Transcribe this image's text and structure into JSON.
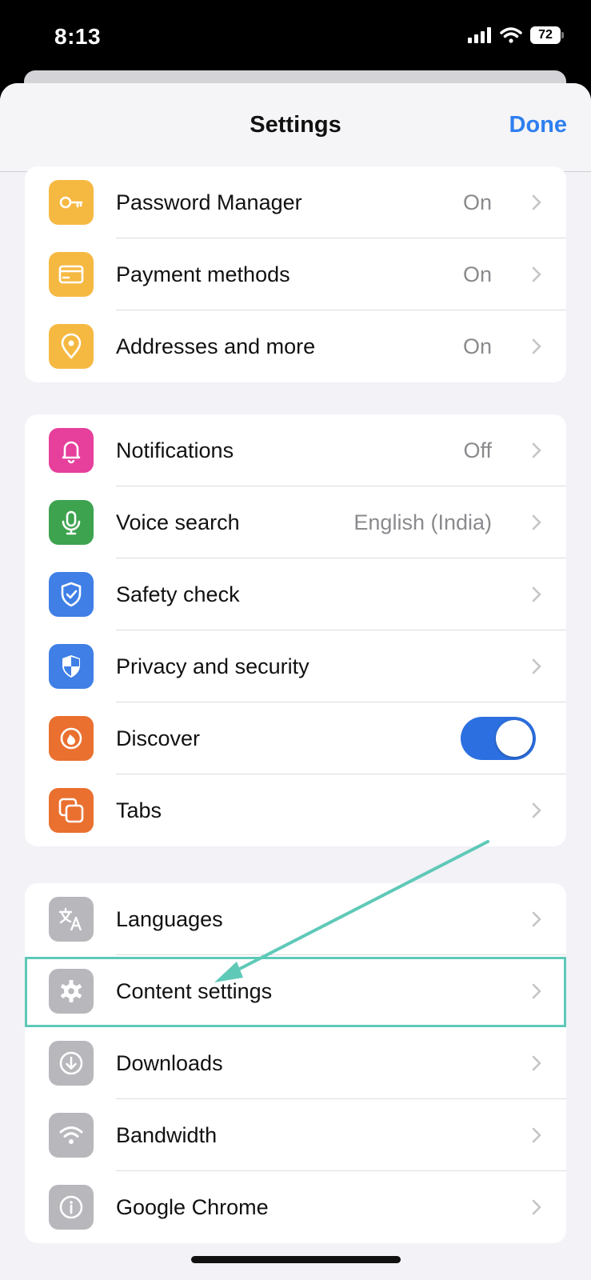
{
  "status": {
    "time": "8:13",
    "battery": "72"
  },
  "nav": {
    "title": "Settings",
    "done": "Done"
  },
  "group1": [
    {
      "label": "Password Manager",
      "value": "On",
      "icon": "key-icon",
      "color": "#f5b942"
    },
    {
      "label": "Payment methods",
      "value": "On",
      "icon": "card-icon",
      "color": "#f5b942"
    },
    {
      "label": "Addresses and more",
      "value": "On",
      "icon": "location-pin-icon",
      "color": "#f5b942"
    }
  ],
  "group2": [
    {
      "label": "Notifications",
      "value": "Off",
      "icon": "bell-icon",
      "color": "#e63f9c"
    },
    {
      "label": "Voice search",
      "value": "English (India)",
      "icon": "microphone-icon",
      "color": "#3ea34f"
    },
    {
      "label": "Safety check",
      "value": "",
      "icon": "shield-check-icon",
      "color": "#3f7fe6"
    },
    {
      "label": "Privacy and security",
      "value": "",
      "icon": "shield-half-icon",
      "color": "#3f7fe6"
    },
    {
      "label": "Discover",
      "toggle": true,
      "toggle_on": true,
      "icon": "flame-icon",
      "color": "#ea7030"
    },
    {
      "label": "Tabs",
      "value": "",
      "icon": "tabs-icon",
      "color": "#ea7030"
    }
  ],
  "group3": [
    {
      "label": "Languages",
      "value": "",
      "icon": "translate-icon",
      "color": "#b7b7bc"
    },
    {
      "label": "Content settings",
      "value": "",
      "icon": "gear-icon",
      "color": "#b7b7bc"
    },
    {
      "label": "Downloads",
      "value": "",
      "icon": "download-icon",
      "color": "#b7b7bc"
    },
    {
      "label": "Bandwidth",
      "value": "",
      "icon": "wifi-icon",
      "color": "#b7b7bc"
    },
    {
      "label": "Google Chrome",
      "value": "",
      "icon": "info-icon",
      "color": "#b7b7bc"
    }
  ],
  "colors": {
    "accent": "#2f7ff0",
    "highlight": "#5fc9b8",
    "toggle": "#2c6fe0"
  }
}
